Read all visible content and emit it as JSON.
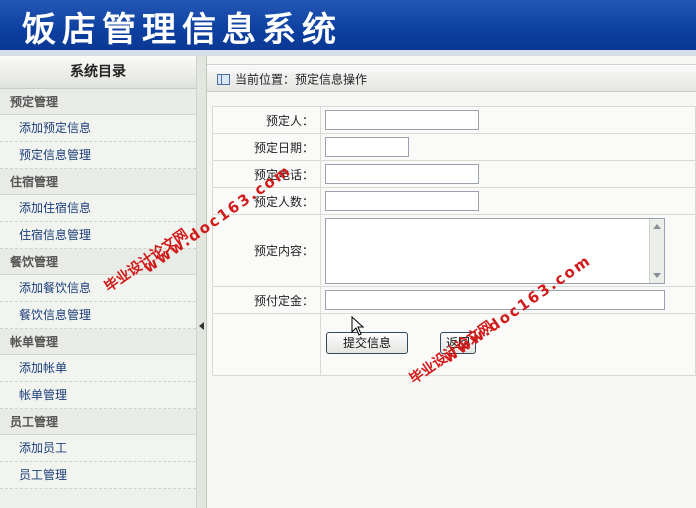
{
  "header": {
    "title": "饭店管理信息系统"
  },
  "sidebar": {
    "title": "系统目录",
    "groups": [
      {
        "title": "预定管理",
        "items": [
          "添加预定信息",
          "预定信息管理"
        ]
      },
      {
        "title": "住宿管理",
        "items": [
          "添加住宿信息",
          "住宿信息管理"
        ]
      },
      {
        "title": "餐饮管理",
        "items": [
          "添加餐饮信息",
          "餐饮信息管理"
        ]
      },
      {
        "title": "帐单管理",
        "items": [
          "添加帐单",
          "帐单管理"
        ]
      },
      {
        "title": "员工管理",
        "items": [
          "添加员工",
          "员工管理"
        ]
      }
    ]
  },
  "location": {
    "text": "当前位置：预定信息操作"
  },
  "form": {
    "booker_label": "预定人：",
    "date_label": "预定日期：",
    "phone_label": "预定电话：",
    "count_label": "预定人数：",
    "content_label": "预定内容：",
    "deposit_label": "预付定金：",
    "booker_value": "",
    "date_value": "",
    "phone_value": "",
    "count_value": "",
    "content_value": "",
    "deposit_value": ""
  },
  "buttons": {
    "submit": "提交信息",
    "back": "返回"
  },
  "watermarks": {
    "site_name": "毕业设计论文网",
    "site_url": "www.doc163.com"
  }
}
